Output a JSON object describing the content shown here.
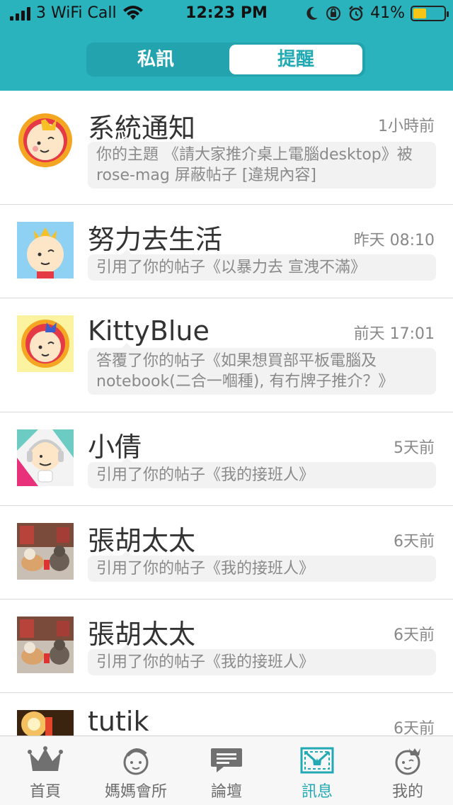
{
  "status_bar": {
    "carrier": "3 WiFi Call",
    "time": "12:23 PM",
    "battery": "41%",
    "battery_level": 0.41
  },
  "header": {
    "tabs": [
      {
        "label": "私訊",
        "active": false
      },
      {
        "label": "提醒",
        "active": true
      }
    ]
  },
  "notifications": [
    {
      "name": "系統通知",
      "time": "1小時前",
      "message": "你的主題 《請大家推介桌上電腦desktop》被 rose-mag 屏蔽帖子 [違規內容]",
      "avatar": "baby-crown-round-icon"
    },
    {
      "name": "努力去生活",
      "time": "昨天 08:10",
      "message": "引用了你的帖子《以暴力去 宣洩不滿》",
      "avatar": "baby-crown-blue-icon"
    },
    {
      "name": "KittyBlue",
      "time": "前天 17:01",
      "message": "答覆了你的帖子《如果想買部平板電腦及notebook(二合一嗰種), 有冇牌子推介？》",
      "avatar": "baby-crown-yellow-icon"
    },
    {
      "name": "小倩",
      "time": "5天前",
      "message": "引用了你的帖子《我的接班人》",
      "avatar": "baby-headphones-icon"
    },
    {
      "name": "張胡太太",
      "time": "6天前",
      "message": "引用了你的帖子《我的接班人》",
      "avatar": "cats-photo"
    },
    {
      "name": "張胡太太",
      "time": "6天前",
      "message": "引用了你的帖子《我的接班人》",
      "avatar": "cats-photo"
    },
    {
      "name": "tutik",
      "time": "6天前",
      "message": "",
      "avatar": "lamp-photo"
    }
  ],
  "tabbar": [
    {
      "label": "首頁",
      "icon": "crown-icon",
      "active": false
    },
    {
      "label": "媽媽會所",
      "icon": "baby-face-icon",
      "active": false
    },
    {
      "label": "論壇",
      "icon": "chat-bubble-icon",
      "active": false
    },
    {
      "label": "訊息",
      "icon": "mail-icon",
      "active": true
    },
    {
      "label": "我的",
      "icon": "baby-profile-icon",
      "active": false
    }
  ],
  "colors": {
    "accent": "#2bb3bd",
    "active_tab": "#22aab4"
  }
}
